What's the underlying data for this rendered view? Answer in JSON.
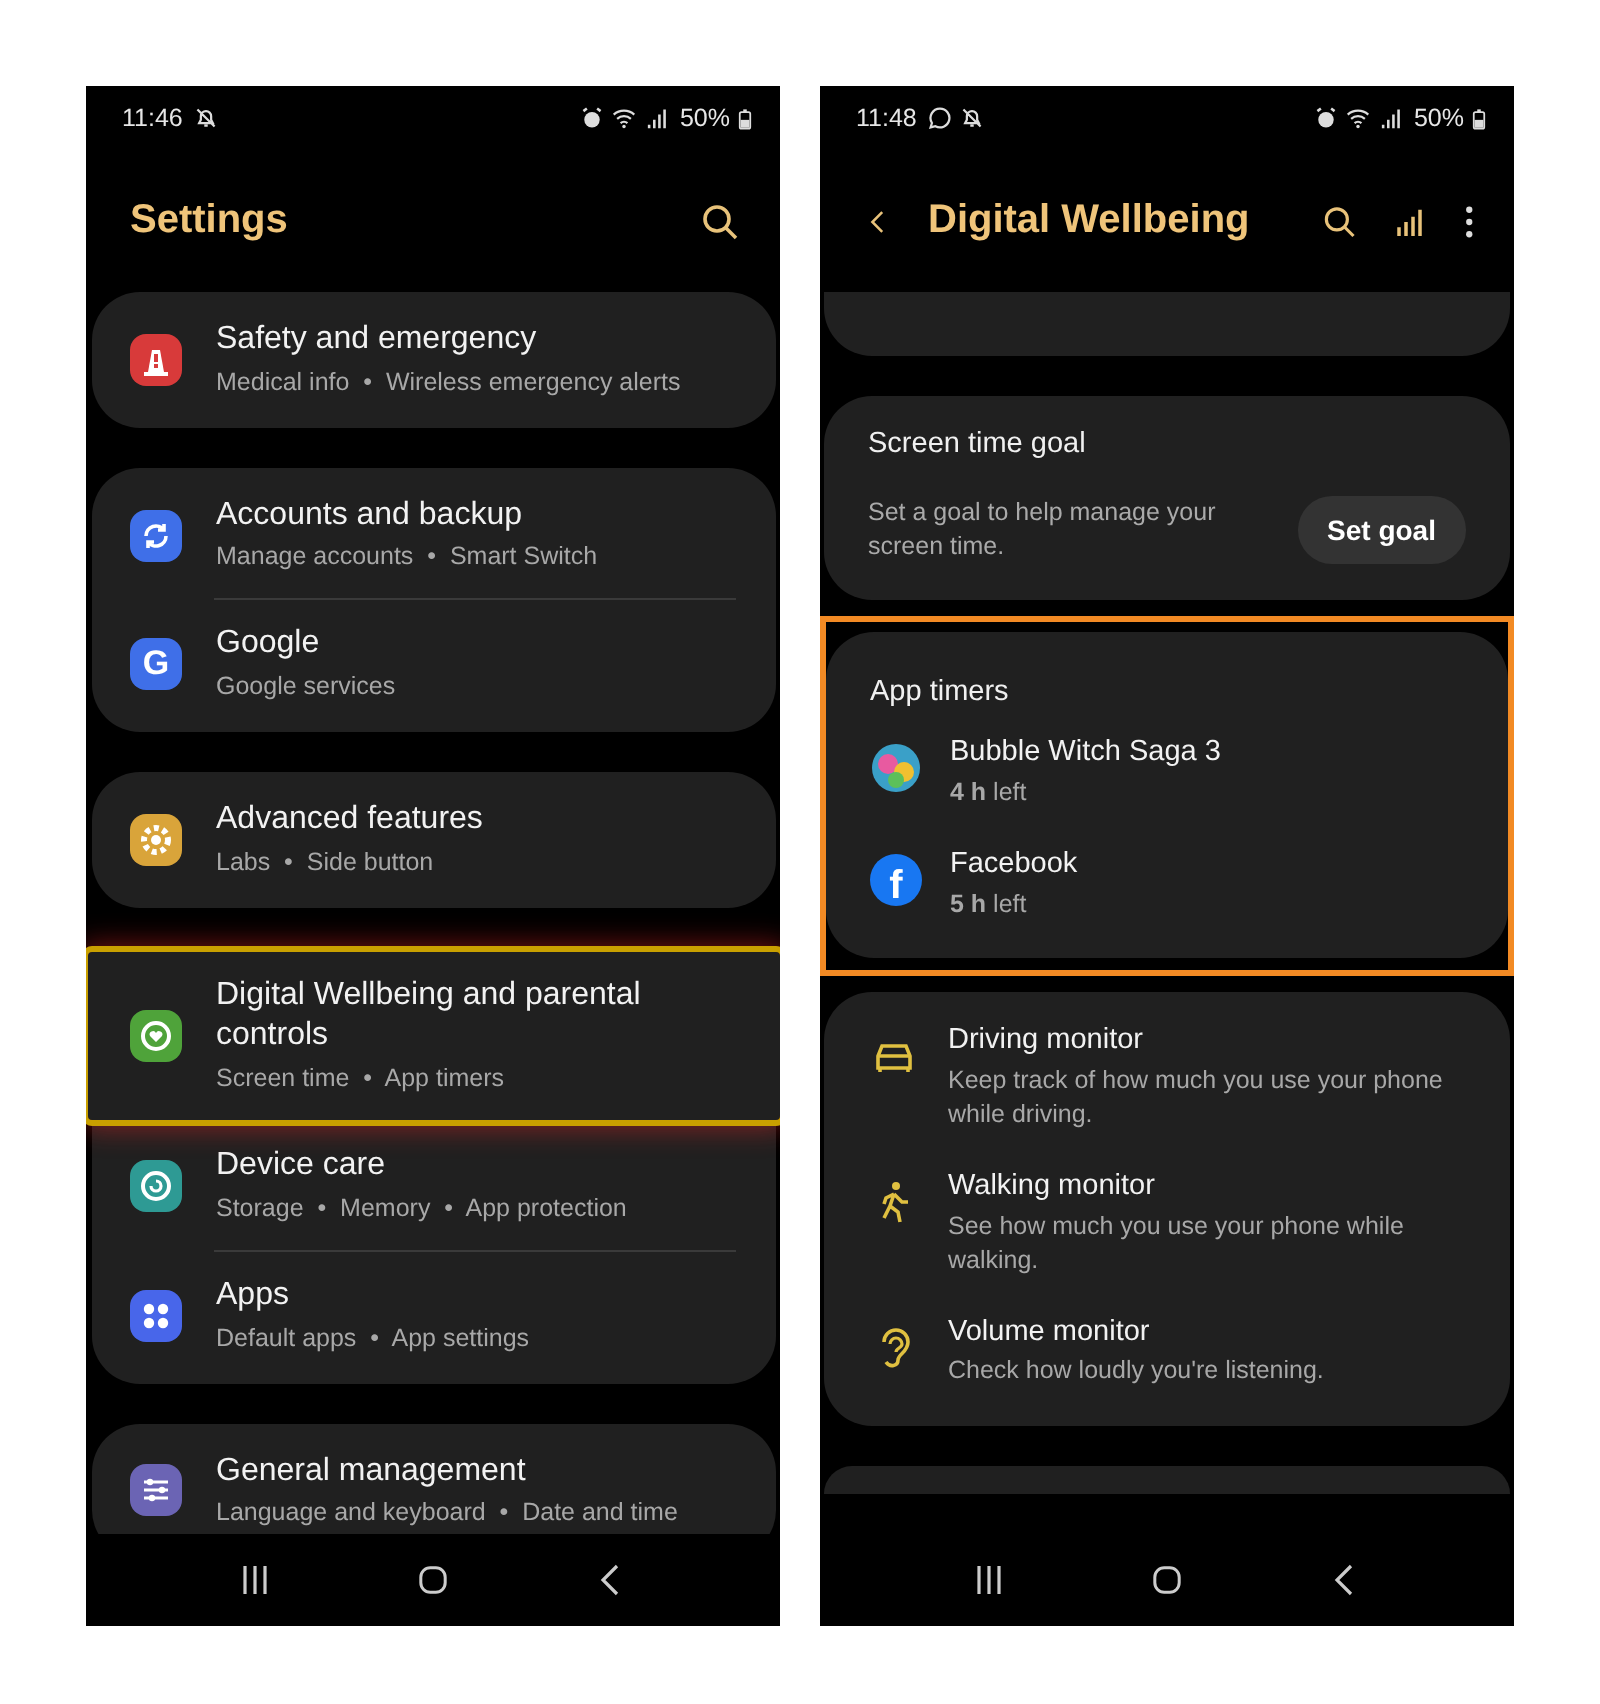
{
  "phones": [
    {
      "status_bar": {
        "time": "11:46",
        "battery": "50%"
      },
      "header": {
        "title": "Settings"
      },
      "cards": [
        {
          "kind": "list",
          "highlighted": false,
          "items": [
            {
              "title": "Safety and emergency",
              "subtitle": "Medical info  •  Wireless emergency alerts",
              "highlighted": false
            }
          ]
        },
        {
          "kind": "list",
          "highlighted": false,
          "items": [
            {
              "title": "Accounts and backup",
              "subtitle": "Manage accounts  •  Smart Switch",
              "highlighted": false
            },
            {
              "icon_text": "G",
              "title": "Google",
              "subtitle": "Google services",
              "highlighted": false
            }
          ]
        },
        {
          "kind": "list",
          "highlighted": false,
          "items": [
            {
              "title": "Advanced features",
              "subtitle": "Labs  •  Side button",
              "highlighted": false
            }
          ]
        },
        {
          "kind": "list",
          "highlighted": false,
          "items": [
            {
              "title": "Digital Wellbeing and parental controls",
              "subtitle": "Screen time  •  App timers",
              "highlighted": true
            },
            {
              "title": "Device care",
              "subtitle": "Storage  •  Memory  •  App protection",
              "highlighted": false
            },
            {
              "title": "Apps",
              "subtitle": "Default apps  •  App settings",
              "highlighted": false
            }
          ]
        },
        {
          "kind": "list",
          "highlighted": false,
          "items": [
            {
              "title": "General management",
              "subtitle": "Language and keyboard  •  Date and time",
              "highlighted": false
            }
          ]
        }
      ]
    },
    {
      "status_bar": {
        "time": "11:48",
        "battery": "50%"
      },
      "header": {
        "title": "Digital Wellbeing"
      },
      "cards": [
        {
          "kind": "stub-top",
          "highlighted": false
        },
        {
          "kind": "goal",
          "highlighted": false,
          "title": "Screen time goal",
          "text": "Set a goal to help manage your screen time.",
          "button": "Set goal"
        },
        {
          "kind": "list",
          "highlighted": true,
          "title": "App timers",
          "items": [
            {
              "title": "Bubble Witch Saga 3",
              "subtitle": "**4 h** left",
              "highlighted": false
            },
            {
              "icon_text": "f",
              "title": "Facebook",
              "subtitle": "**5 h** left",
              "highlighted": false
            }
          ]
        },
        {
          "kind": "list",
          "highlighted": false,
          "items": [
            {
              "title": "Driving monitor",
              "subtitle": "Keep track of how much you use your phone while driving.",
              "highlighted": false
            },
            {
              "title": "Walking monitor",
              "subtitle": "See how much you use your phone while walking.",
              "highlighted": false
            },
            {
              "title": "Volume monitor",
              "subtitle": "Check how loudly you're listening.",
              "highlighted": false
            }
          ]
        },
        {
          "kind": "stub-bottom",
          "highlighted": false
        }
      ]
    }
  ]
}
